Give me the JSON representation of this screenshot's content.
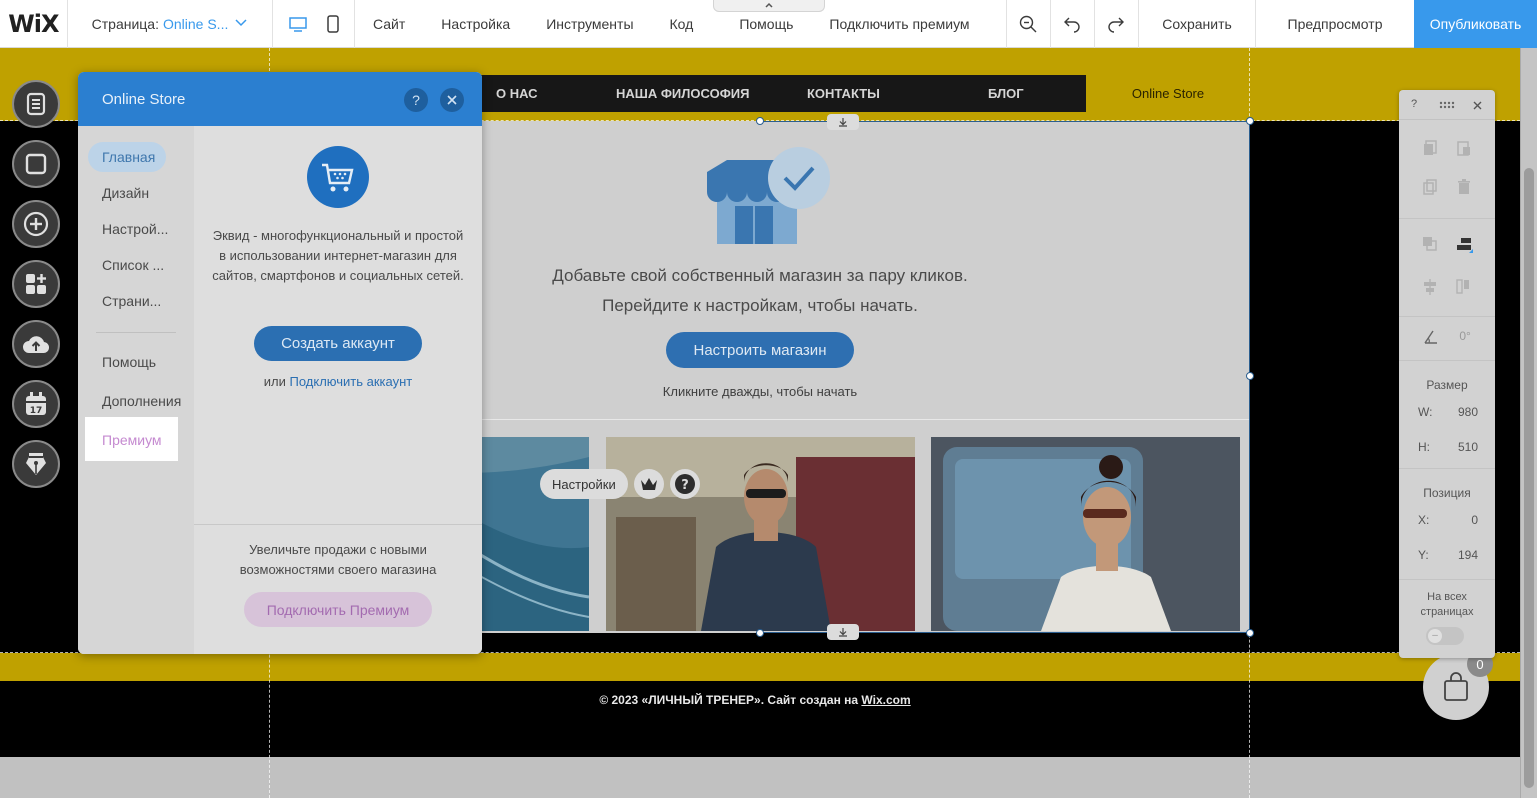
{
  "topbar": {
    "logo": "WiX",
    "page_label": "Страница:",
    "page_value": "Online S...",
    "menu": [
      "Сайт",
      "Настройка",
      "Инструменты",
      "Код",
      "Помощь",
      "Подключить премиум"
    ],
    "save": "Сохранить",
    "preview": "Предпросмотр",
    "publish": "Опубликовать"
  },
  "site": {
    "nav": [
      "О НАС",
      "НАША ФИЛОСОФИЯ",
      "КОНТАКТЫ",
      "БЛОГ"
    ],
    "nav_store": "Online Store",
    "store_line1": "Добавьте свой собственный магазин за пару кликов.",
    "store_line2": "Перейдите к настройкам, чтобы начать.",
    "store_button": "Настроить магазин",
    "store_hint": "Кликните дважды, чтобы начать",
    "float_settings": "Настройки",
    "footer_prefix": "© 2023 «ЛИЧНЫЙ ТРЕНЕР». Сайт создан на ",
    "footer_link": "Wix.com",
    "cart_count": "0"
  },
  "panel": {
    "title": "Online Store",
    "help": "?",
    "side": [
      "Главная",
      "Дизайн",
      "Настрой...",
      "Список ...",
      "Страни..."
    ],
    "side_bottom": [
      "Помощь",
      "Дополнения",
      "Премиум"
    ],
    "description": "Эквид - многофункциональный и простой в использовании интернет-магазин для сайтов, смартфонов и социальных сетей.",
    "create_account": "Создать аккаунт",
    "or": "или ",
    "connect_account": "Подключить аккаунт",
    "upsell": "Увеличьте продажи с новыми возможностями своего магазина",
    "premium_button": "Подключить Премиум"
  },
  "inspector": {
    "help": "?",
    "rotation": "0°",
    "size_label": "Размер",
    "w_label": "W:",
    "w_value": "980",
    "h_label": "H:",
    "h_value": "510",
    "pos_label": "Позиция",
    "x_label": "X:",
    "x_value": "0",
    "y_label": "Y:",
    "y_value": "194",
    "all_pages": "На всех страницах"
  },
  "colors": {
    "accent": "#3899ec",
    "site_yellow": "#bfa100",
    "premium": "#a36bb0"
  }
}
